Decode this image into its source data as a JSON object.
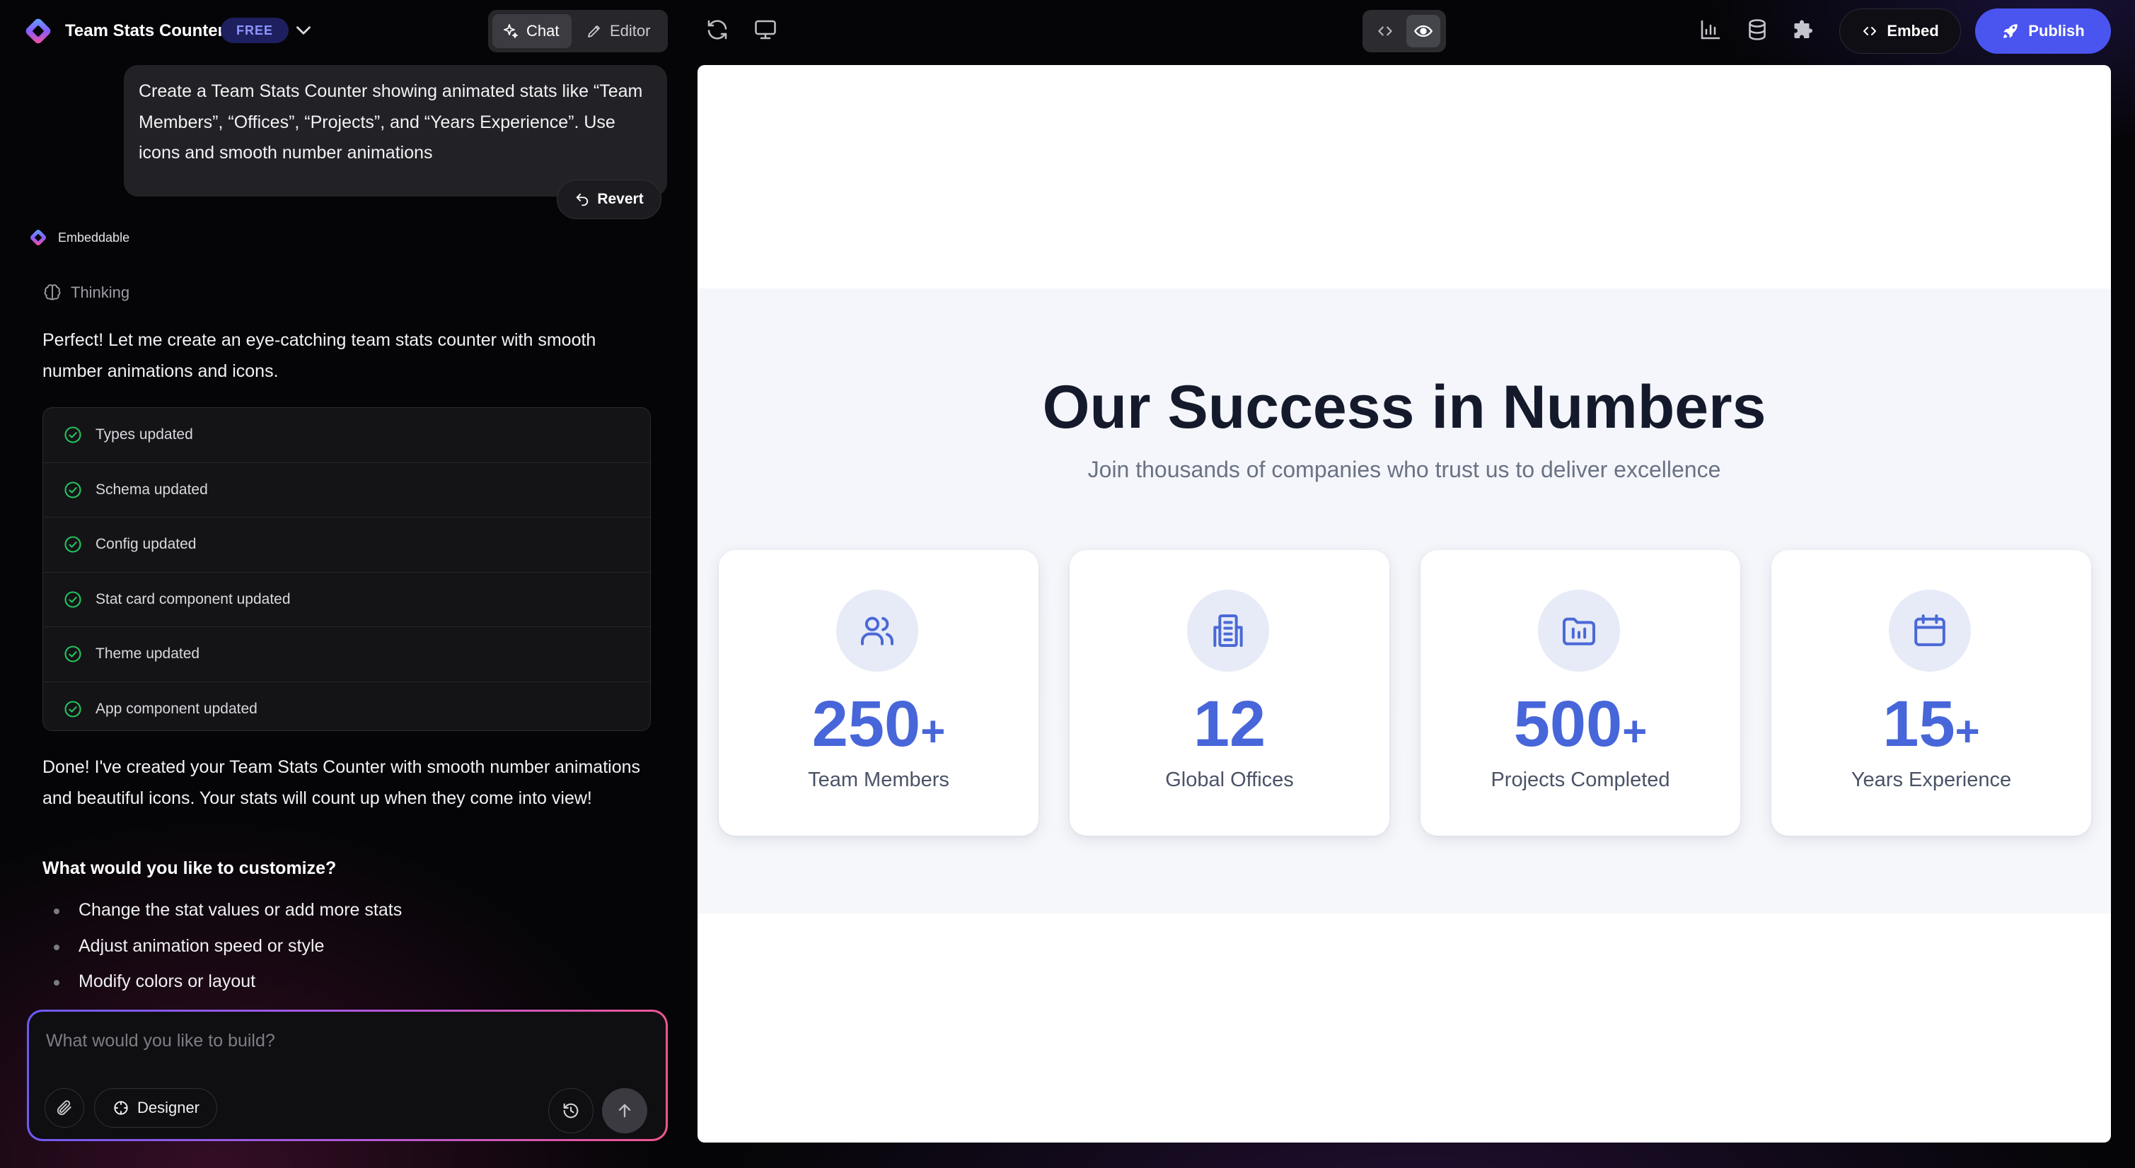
{
  "topbar": {
    "app_title": "Team Stats Counter",
    "plan_badge": "FREE",
    "mode_tabs": [
      {
        "label": "Chat",
        "icon": "sparkle-icon",
        "active": true
      },
      {
        "label": "Editor",
        "icon": "pencil-icon",
        "active": false
      }
    ],
    "left_icons": [
      "refresh-icon",
      "monitor-icon"
    ],
    "view_toggle": [
      {
        "icon": "code-icon",
        "active": false
      },
      {
        "icon": "eye-icon",
        "active": true
      }
    ],
    "right_icons": [
      "bar-chart-icon",
      "database-icon",
      "puzzle-icon"
    ],
    "embed_label": "Embed",
    "publish_label": "Publish",
    "accent_color": "#4a55f0"
  },
  "chat": {
    "user_message": "Create a Team Stats Counter showing animated stats like “Team Members”, “Offices”, “Projects”, and “Years Experience”. Use icons and smooth number animations",
    "revert_label": "Revert",
    "bot_name": "Embeddable",
    "thinking_label": "Thinking",
    "intro": "Perfect! Let me create an eye-catching team stats counter with smooth number animations and icons.",
    "updates": [
      "Types updated",
      "Schema updated",
      "Config updated",
      "Stat card component updated",
      "Theme updated",
      "App component updated"
    ],
    "summary": "Done! I've created your Team Stats Counter with smooth number animations and beautiful icons. Your stats will count up when they come into view!",
    "question": "What would you like to customize?",
    "suggestions": [
      "Change the stat values or add more stats",
      "Adjust animation speed or style",
      "Modify colors or layout"
    ],
    "status_color": "#22c55e"
  },
  "composer": {
    "placeholder": "What would you like to build?",
    "designer_label": "Designer"
  },
  "preview": {
    "headline": "Our Success in Numbers",
    "subheadline": "Join thousands of companies who trust us to deliver excellence",
    "stat_color": "#4766d9",
    "stats": [
      {
        "value": "250",
        "suffix": "+",
        "label": "Team Members",
        "icon": "users-icon"
      },
      {
        "value": "12",
        "suffix": "",
        "label": "Global Offices",
        "icon": "building-icon"
      },
      {
        "value": "500",
        "suffix": "+",
        "label": "Projects Completed",
        "icon": "folder-chart-icon"
      },
      {
        "value": "15",
        "suffix": "+",
        "label": "Years Experience",
        "icon": "calendar-icon"
      }
    ]
  }
}
